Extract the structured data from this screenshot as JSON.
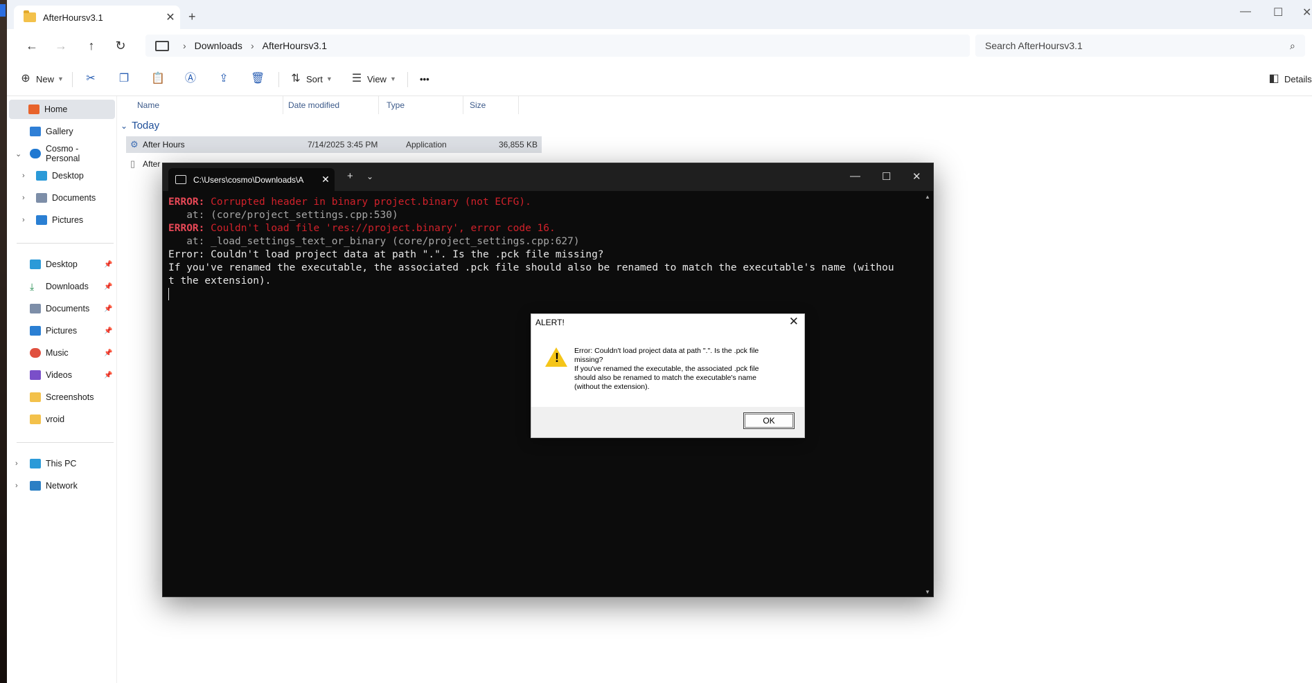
{
  "window": {
    "tab_title": "AfterHoursv3.1",
    "new_tab": "+",
    "close": "✕",
    "minimize": "—",
    "maximize": "☐",
    "win_close": "✕"
  },
  "nav": {
    "breadcrumb": [
      "Downloads",
      "AfterHoursv3.1"
    ],
    "search_placeholder": "Search AfterHoursv3.1"
  },
  "toolbar": {
    "new_label": "New",
    "sort_label": "Sort",
    "view_label": "View",
    "more_label": "•••",
    "details_label": "Details"
  },
  "sidebar": {
    "items": [
      {
        "label": "Home",
        "icon": "home-icon",
        "active": true
      },
      {
        "label": "Gallery",
        "icon": "gallery-icon"
      },
      {
        "label": "Cosmo - Personal",
        "icon": "cloud-icon"
      },
      {
        "label": "Desktop",
        "icon": "desktop-icon"
      },
      {
        "label": "Documents",
        "icon": "documents-icon"
      },
      {
        "label": "Pictures",
        "icon": "pictures-icon"
      }
    ],
    "quick_access": [
      {
        "label": "Desktop",
        "icon": "desktop-icon",
        "pinned": true
      },
      {
        "label": "Downloads",
        "icon": "download-icon",
        "pinned": true
      },
      {
        "label": "Documents",
        "icon": "documents-icon",
        "pinned": true
      },
      {
        "label": "Pictures",
        "icon": "pictures-icon",
        "pinned": true
      },
      {
        "label": "Music",
        "icon": "music-icon",
        "pinned": true
      },
      {
        "label": "Videos",
        "icon": "videos-icon",
        "pinned": true
      },
      {
        "label": "Screenshots",
        "icon": "folder-icon"
      },
      {
        "label": "vroid",
        "icon": "folder-icon"
      }
    ],
    "bottom": [
      {
        "label": "This PC",
        "icon": "pc-icon"
      },
      {
        "label": "Network",
        "icon": "network-icon"
      }
    ]
  },
  "files": {
    "columns": [
      "Name",
      "Date modified",
      "Type",
      "Size"
    ],
    "group": "Today",
    "rows": [
      {
        "name": "After Hours",
        "date": "7/14/2025 3:45 PM",
        "type": "Application",
        "size": "36,855 KB",
        "selected": true
      },
      {
        "name": "After",
        "date": "",
        "type": "",
        "size": ""
      }
    ]
  },
  "terminal": {
    "tab_title": "C:\\Users\\cosmo\\Downloads\\A",
    "lines": [
      {
        "label": "ERROR:",
        "text": " Corrupted header in binary project.binary (not ECFG)."
      },
      {
        "text": "   at: (core/project_settings.cpp:530)"
      },
      {
        "label": "ERROR:",
        "text": " Couldn't load file 'res://project.binary', error code 16."
      },
      {
        "text": "   at: _load_settings_text_or_binary (core/project_settings.cpp:627)"
      },
      {
        "text": "Error: Couldn't load project data at path \".\". Is the .pck file missing?"
      },
      {
        "text": "If you've renamed the executable, the associated .pck file should also be renamed to match the executable's name (withou"
      },
      {
        "text": "t the extension)."
      }
    ]
  },
  "alert": {
    "title": "ALERT!",
    "message_lines": [
      "Error: Couldn't load project data at path \".\". Is the .pck file",
      "missing?",
      "If you've renamed the executable, the associated .pck file",
      "should also be renamed to match the executable's name",
      "(without the extension)."
    ],
    "ok_label": "OK"
  },
  "colors": {
    "error_label": "#e74856",
    "error_text": "#d1212a",
    "terminal_bg": "#0c0c0c",
    "accent": "#2a5fb4"
  }
}
